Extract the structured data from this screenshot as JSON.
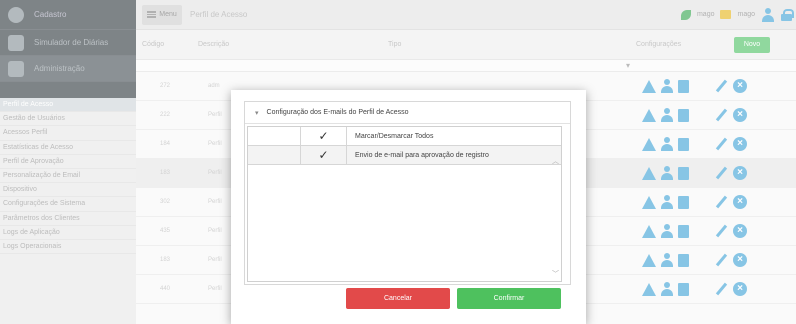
{
  "sidebar": {
    "title": "Cadastro",
    "items": [
      {
        "label": "Simulador de Diárias"
      },
      {
        "label": "Administração"
      }
    ],
    "submenu": [
      "Perfil de Acesso",
      "Gestão de Usuários",
      "Acessos Perfil",
      "Estatísticas de Acesso",
      "Perfil de Aprovação",
      "Personalização de Email",
      "Dispositivo",
      "Configurações de Sistema",
      "Parâmetros dos Clientes",
      "Logs de Aplicação",
      "Logs Operacionais"
    ]
  },
  "topbar": {
    "menu_label": "Menu",
    "page_title": "Perfil de Acesso",
    "user1": "mago",
    "user2": "mago"
  },
  "table": {
    "headers": {
      "code": "Código",
      "description": "Descrição",
      "type": "Tipo",
      "config": "Configurações",
      "new_button": "Novo"
    },
    "rows": [
      {
        "code": "272",
        "desc": "adm"
      },
      {
        "code": "222",
        "desc": "Perfil"
      },
      {
        "code": "184",
        "desc": "Perfil"
      },
      {
        "code": "183",
        "desc": "Perfil"
      },
      {
        "code": "302",
        "desc": "Perfil"
      },
      {
        "code": "435",
        "desc": "Perfil"
      },
      {
        "code": "183",
        "desc": "Perfil"
      },
      {
        "code": "440",
        "desc": "Perfil"
      }
    ]
  },
  "modal": {
    "panel_title": "Configuração dos E-mails do Perfil de Acesso",
    "options": [
      {
        "label": "Marcar/Desmarcar Todos",
        "checked": true
      },
      {
        "label": "Envio de e-mail para aprovação de registro",
        "checked": true
      }
    ],
    "check_glyph": "✓",
    "cancel_label": "Cancelar",
    "confirm_label": "Confirmar"
  },
  "colors": {
    "accent": "#48a7d8",
    "cancel": "#e24a4a",
    "confirm": "#4ec15e",
    "sidebar": "#3a4248"
  }
}
